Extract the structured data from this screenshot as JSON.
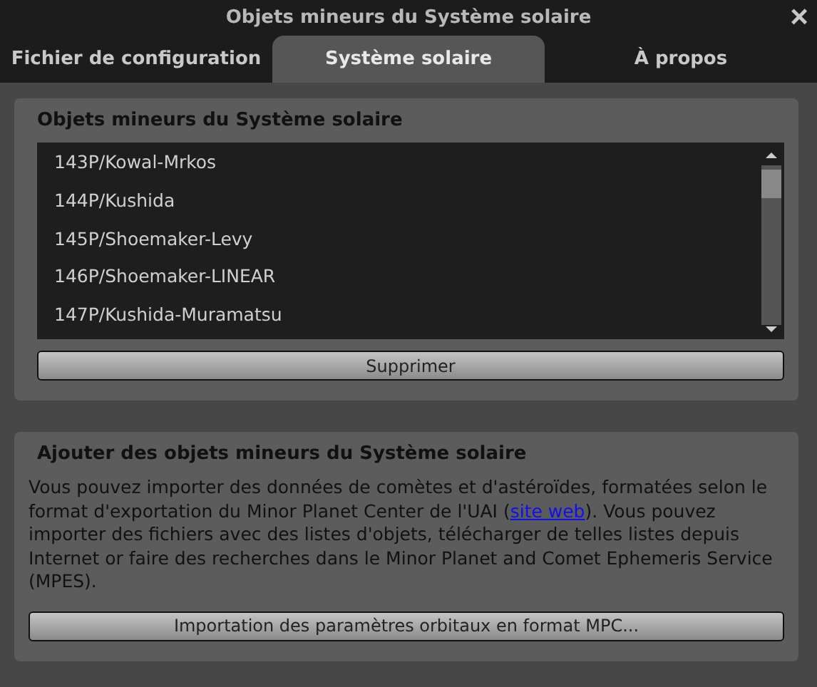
{
  "window": {
    "title": "Objets mineurs du Système solaire",
    "close": "×"
  },
  "tabs": [
    {
      "label": "Fichier de configuration",
      "selected": false
    },
    {
      "label": "Système solaire",
      "selected": true
    },
    {
      "label": "À propos",
      "selected": false
    }
  ],
  "objects_group": {
    "title": "Objets mineurs du Système solaire",
    "items": [
      "143P/Kowal-Mrkos",
      "144P/Kushida",
      "145P/Shoemaker-Levy",
      "146P/Shoemaker-LINEAR",
      "147P/Kushida-Muramatsu"
    ],
    "button": "Supprimer"
  },
  "add_group": {
    "title": "Ajouter des objets mineurs du Système solaire",
    "text_before": "Vous pouvez importer des données de comètes et d'astéroïdes, formatées selon le format d'exportation du Minor Planet Center de l'UAI (",
    "link": "site web",
    "text_after": "). Vous pouvez importer des fichiers avec des listes d'objets, télécharger de telles listes depuis Internet or faire des recherches dans le Minor Planet and Comet Ephemeris Service (MPES).",
    "button": "Importation des paramètres orbitaux en format MPC..."
  }
}
